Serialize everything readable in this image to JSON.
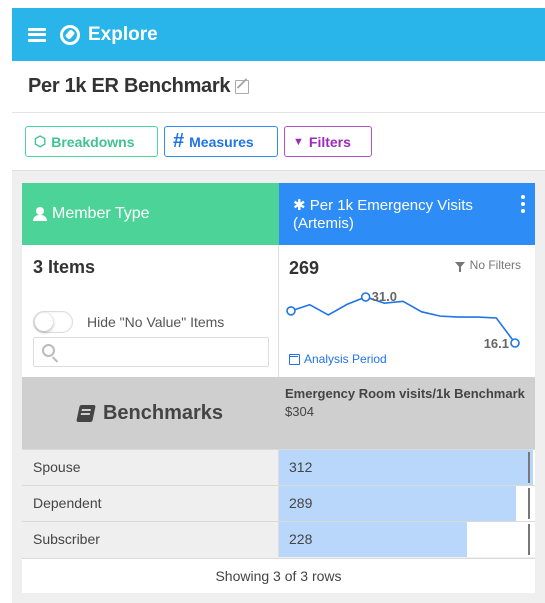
{
  "topbar": {
    "title": "Explore",
    "menu_icon": "hamburger-icon",
    "brand_icon": "compass-icon",
    "color": "#29b5ea"
  },
  "page": {
    "title": "Per 1k ER Benchmark",
    "edit_icon": "edit-icon"
  },
  "tabs": [
    {
      "label": "Breakdowns",
      "icon": "cube-icon",
      "color": "#3fc393"
    },
    {
      "label": "Measures",
      "icon": "hashtag-icon",
      "color": "#2074e6"
    },
    {
      "label": "Filters",
      "icon": "filter-icon",
      "color": "#9d2bb8"
    }
  ],
  "breakdown": {
    "header": "Member Type",
    "header_color": "#4cd398",
    "items_count": "3 Items",
    "toggle_label": "Hide \"No Value\" Items",
    "toggle_on": false,
    "search_value": "",
    "search_placeholder": ""
  },
  "measure": {
    "header": "Per 1k Emergency Visits (Artemis)",
    "header_prefix": "✱",
    "header_color": "#2d8cf6",
    "value": "269",
    "filters_label": "No Filters",
    "sparkline": {
      "peak_label": "31.0",
      "end_label": "16.1",
      "values": [
        26.5,
        28.5,
        25.2,
        28.6,
        31.0,
        29.0,
        29.6,
        26.2,
        24.8,
        24.5,
        24.5,
        24.2,
        16.1
      ]
    },
    "analysis_label": "Analysis Period"
  },
  "benchmarks": {
    "label": "Benchmarks",
    "column_title": "Emergency Room visits/1k Benchmark",
    "column_value": "$304"
  },
  "rows": [
    {
      "label": "Spouse",
      "value": "312",
      "fill": 0.994
    },
    {
      "label": "Dependent",
      "value": "289",
      "fill": 0.924
    },
    {
      "label": "Subscriber",
      "value": "228",
      "fill": 0.734
    }
  ],
  "footer": "Showing 3 of 3 rows"
}
